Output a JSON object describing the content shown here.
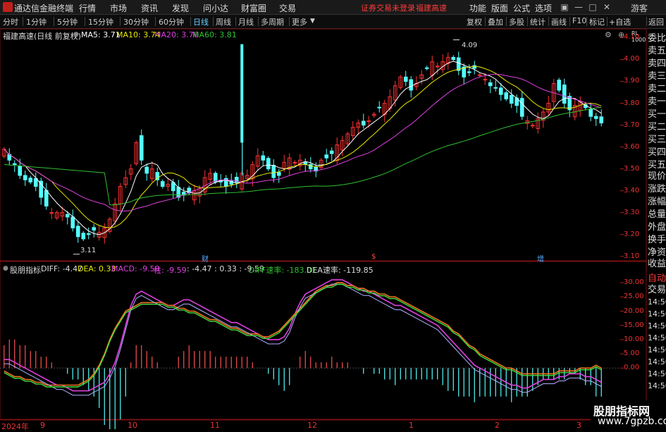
{
  "app": {
    "title": "通达信金融终端"
  },
  "menu": [
    "行情",
    "市场",
    "资讯",
    "发现",
    "问小达",
    "财富圈",
    "交易"
  ],
  "status": {
    "login": "证券交易未登录",
    "stock": "福建高速"
  },
  "right_menu": [
    "功能",
    "版面",
    "公式",
    "选项"
  ],
  "guest": "游客",
  "period_tabs": [
    "分时",
    "1分钟",
    "5分钟",
    "15分钟",
    "30分钟",
    "60分钟",
    "日线",
    "周线",
    "月线",
    "多周期",
    "更多"
  ],
  "active_period": "日线",
  "tools": [
    "复权",
    "叠加",
    "多股",
    "统计",
    "画线",
    "F10",
    "标记",
    "+自选",
    "返回"
  ],
  "main_info": {
    "title": "福建高速(日线 前复权)",
    "ma5": "MA5: 3.71",
    "ma10": "MA10: 3.74",
    "ma20": "MA20: 3.76",
    "ma60": "MA60: 3.81"
  },
  "price_axis": [
    "4.10",
    "4.00",
    "3.90",
    "3.80",
    "3.70",
    "3.60",
    "3.50",
    "3.40",
    "3.30",
    "3.20",
    "3.10"
  ],
  "annotations": {
    "high": "4.09",
    "low": "3.11",
    "m1": "财",
    "m2": "$",
    "m3": "增"
  },
  "sub_info": {
    "name": "股朋指标",
    "diff": "DIFF: -4.47",
    "dea": "DEA: 0.33",
    "macd": "MACD: -9.59",
    "zhu": "柱: -9.59",
    "tail": ": -4.47  : 0.33  : -9.59",
    "diffspeed": "DIFF速率: -183.01",
    "deaspeed": "DEA速率: -119.85"
  },
  "sub_axis": [
    "30.00",
    "25.00",
    "20.00",
    "15.00",
    "10.00",
    "5.00",
    "0.00"
  ],
  "x_axis": [
    "2024年",
    "9",
    "10",
    "11",
    "12",
    "1",
    "2",
    "3"
  ],
  "right_tabs": [
    "委比",
    "卖五",
    "卖四",
    "卖三",
    "卖二",
    "卖一",
    "买一",
    "买二",
    "买三",
    "买四",
    "买五",
    "现价",
    "涨跌",
    "涨幅",
    "总量",
    "外盘",
    "换手",
    "净资",
    "收益",
    "自动",
    "交易",
    "14:56",
    "14:56",
    "14:56",
    "14:56",
    "14:56",
    "14:56",
    "14:56",
    "14:56"
  ],
  "watermark": {
    "line1": "股朋指标网",
    "line2": "www.7gpzb.com"
  },
  "chart_data": [
    {
      "type": "candlestick",
      "title": "福建高速(日线 前复权)",
      "series": [
        {
          "name": "MA5",
          "color": "#ffffff"
        },
        {
          "name": "MA10",
          "color": "#e8e800"
        },
        {
          "name": "MA20",
          "color": "#e040e0"
        },
        {
          "name": "MA60",
          "color": "#30c030"
        }
      ],
      "ylim": [
        3.08,
        4.14
      ],
      "ma_last": {
        "MA5": 3.71,
        "MA10": 3.74,
        "MA20": 3.76,
        "MA60": 3.81
      },
      "marked_high": 4.09,
      "marked_low": 3.11,
      "closes": [
        3.59,
        3.54,
        3.52,
        3.47,
        3.45,
        3.44,
        3.42,
        3.37,
        3.33,
        3.3,
        3.3,
        3.3,
        3.28,
        3.23,
        3.19,
        3.18,
        3.2,
        3.22,
        3.21,
        3.23,
        3.27,
        3.34,
        3.42,
        3.46,
        3.5,
        3.62,
        3.54,
        3.48,
        3.5,
        3.45,
        3.42,
        3.43,
        3.4,
        3.37,
        3.38,
        3.39,
        3.4,
        3.41,
        3.46,
        3.48,
        3.44,
        3.44,
        3.42,
        3.43,
        3.44,
        3.48,
        3.47,
        3.52,
        3.56,
        3.54,
        3.5,
        3.46,
        3.47,
        3.53,
        3.55,
        3.53,
        3.54,
        3.52,
        3.5,
        3.49,
        3.54,
        3.55,
        3.57,
        3.61,
        3.63,
        3.66,
        3.69,
        3.71,
        3.7,
        3.72,
        3.75,
        3.78,
        3.8,
        3.83,
        3.88,
        3.92,
        3.9,
        3.86,
        3.89,
        3.93,
        3.96,
        3.99,
        3.97,
        3.99,
        4.01,
        4.0,
        3.95,
        3.92,
        3.94,
        3.96,
        3.93,
        3.91,
        3.88,
        3.87,
        3.84,
        3.82,
        3.8,
        3.79,
        3.74,
        3.72,
        3.7,
        3.73,
        3.76,
        3.8,
        3.89,
        3.86,
        3.8,
        3.77,
        3.79,
        3.81,
        3.78,
        3.74,
        3.73,
        3.71
      ]
    },
    {
      "type": "line",
      "title": "股朋指标",
      "ylim": [
        -18,
        33
      ],
      "series": [
        {
          "name": "DIFF",
          "last": -4.47,
          "color": "#e040e0"
        },
        {
          "name": "DEA",
          "last": 0.33,
          "color": "#f07820"
        },
        {
          "name": "MACD",
          "last": -9.59
        }
      ],
      "diff": [
        3,
        3,
        2,
        1,
        0,
        -1,
        -2,
        -3,
        -4,
        -5,
        -6,
        -6,
        -7,
        -8,
        -8,
        -8,
        -8,
        -7,
        -6,
        -5,
        -2,
        2,
        8,
        15,
        22,
        26,
        27,
        26,
        25,
        24,
        23,
        22,
        22,
        23,
        24,
        24,
        23,
        22,
        21,
        20,
        19,
        18,
        17,
        16,
        16,
        15,
        14,
        13,
        12,
        11,
        10,
        10,
        10,
        11,
        14,
        19,
        23,
        26,
        27,
        28,
        29,
        30,
        31,
        31,
        31,
        30,
        29,
        28,
        27,
        27,
        26,
        25,
        24,
        23,
        22,
        22,
        21,
        20,
        19,
        18,
        17,
        16,
        15,
        13,
        11,
        9,
        7,
        5,
        3,
        1,
        0,
        -1,
        -2,
        -3,
        -4,
        -5,
        -6,
        -6,
        -7,
        -7,
        -6,
        -5,
        -4,
        -4,
        -4,
        -3,
        -3,
        -2,
        -2,
        -2,
        -3,
        -3,
        -4,
        -5
      ],
      "dea": [
        -1,
        -2,
        -3,
        -3,
        -4,
        -4,
        -5,
        -5,
        -6,
        -6,
        -6,
        -6,
        -6,
        -6,
        -6,
        -5,
        -4,
        -2,
        1,
        5,
        10,
        14,
        17,
        20,
        21,
        22,
        23,
        23,
        23,
        23,
        23,
        22,
        22,
        21,
        21,
        20,
        20,
        19,
        18,
        17,
        17,
        16,
        15,
        14,
        14,
        13,
        12,
        12,
        12,
        11,
        11,
        12,
        13,
        15,
        17,
        19,
        21,
        23,
        25,
        27,
        28,
        29,
        29,
        30,
        30,
        29,
        29,
        28,
        28,
        27,
        27,
        26,
        26,
        25,
        25,
        24,
        23,
        22,
        21,
        20,
        19,
        18,
        17,
        16,
        15,
        13,
        12,
        10,
        8,
        7,
        5,
        4,
        3,
        2,
        1,
        0,
        0,
        -1,
        -2,
        -2,
        -2,
        -2,
        -2,
        -2,
        -2,
        -1,
        -1,
        -1,
        -1,
        0,
        0,
        0,
        1,
        0
      ]
    }
  ]
}
